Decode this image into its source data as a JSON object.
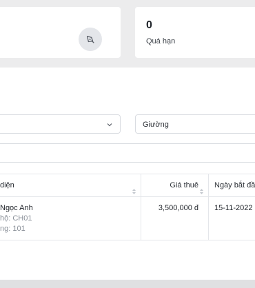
{
  "stats": {
    "left": {
      "icon": "pen-icon"
    },
    "overdue": {
      "value": "0",
      "label": "Quá hạn"
    }
  },
  "filters": {
    "left_value": "",
    "right_value": "Giường"
  },
  "table": {
    "headers": {
      "col1": "diện",
      "col2": "Giá thuê",
      "col3": "Ngày bắt đầ"
    },
    "rows": [
      {
        "name": "Ngọc Anh",
        "apartment": "hộ: CH01",
        "room": "ng: 101",
        "price": "3,500,000 đ",
        "start": "15-11-2022"
      }
    ]
  }
}
